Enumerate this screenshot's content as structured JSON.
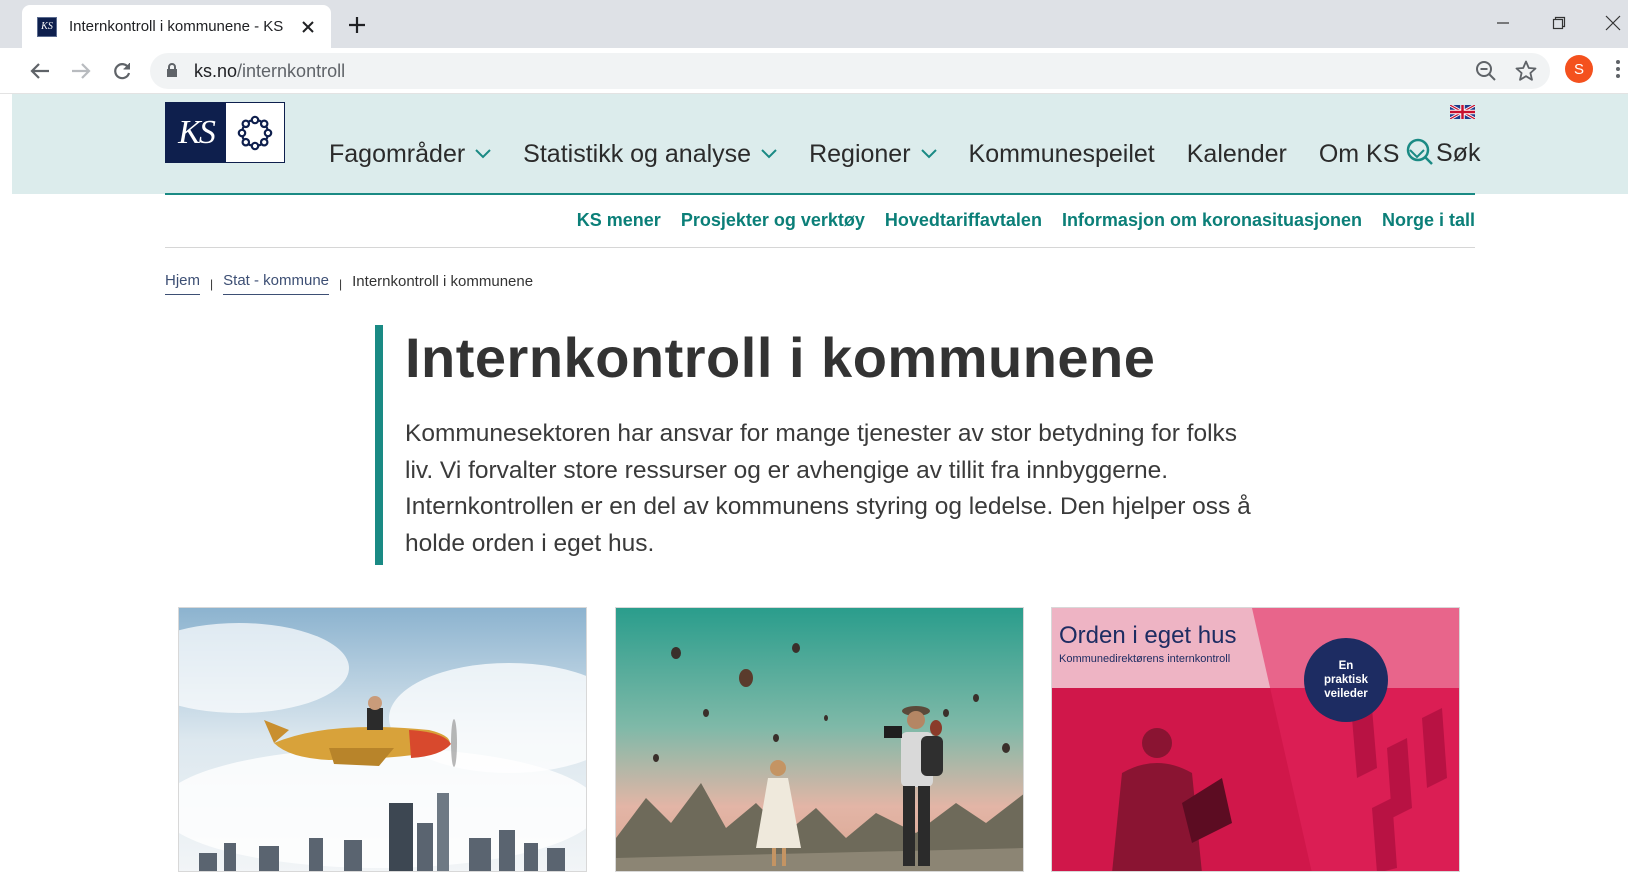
{
  "browser": {
    "tab_title": "Internkontroll i kommunene - KS",
    "url_domain": "ks.no",
    "url_path": "/internkontroll",
    "profile_initial": "S"
  },
  "header": {
    "logo_text": "KS",
    "nav": [
      {
        "label": "Fagområder",
        "has_dropdown": true
      },
      {
        "label": "Statistikk og analyse",
        "has_dropdown": true
      },
      {
        "label": "Regioner",
        "has_dropdown": true
      },
      {
        "label": "Kommunespeilet",
        "has_dropdown": false
      },
      {
        "label": "Kalender",
        "has_dropdown": false
      },
      {
        "label": "Om KS",
        "has_dropdown": true
      }
    ],
    "search_label": "Søk"
  },
  "subnav": [
    "KS mener",
    "Prosjekter og verktøy",
    "Hovedtariffavtalen",
    "Informasjon om koronasituasjonen",
    "Norge i tall"
  ],
  "breadcrumb": {
    "items": [
      "Hjem",
      "Stat - kommune"
    ],
    "current": "Internkontroll i kommunene"
  },
  "hero": {
    "title": "Internkontroll i kommunene",
    "lead_lines": [
      "Kommunesektoren har ansvar for mange tjenester av stor betydning for folks",
      "liv. Vi forvalter store ressurser og er avhengige av tillit fra innbyggerne.",
      "Internkontrollen er en del av kommunens styring og ledelse. Den hjelper oss å",
      "holde orden i eget hus."
    ]
  },
  "cards": {
    "card3": {
      "title": "Orden i eget hus",
      "subtitle": "Kommunedirektørens internkontroll",
      "badge": [
        "En",
        "praktisk",
        "veileder"
      ]
    }
  },
  "colors": {
    "accent": "#1a8a84",
    "header_bg": "#dcecec",
    "brand_navy": "#0e1f4d",
    "link": "#0b7f78"
  }
}
